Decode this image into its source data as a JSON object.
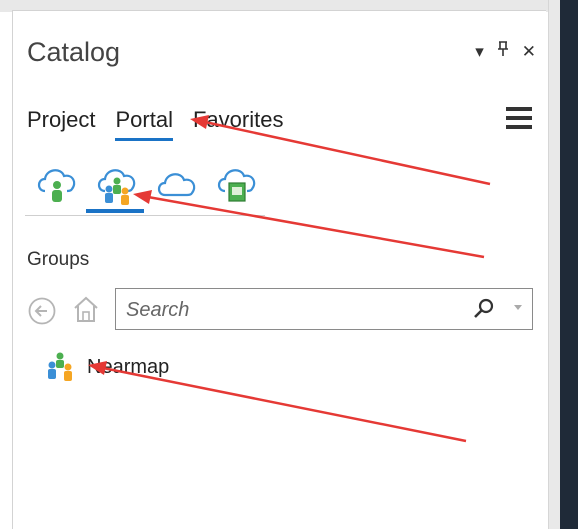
{
  "catalog": {
    "title": "Catalog",
    "controls": [
      "dropdown",
      "pin",
      "close"
    ]
  },
  "tabs": [
    {
      "label": "Project",
      "active": false
    },
    {
      "label": "Portal",
      "active": true
    },
    {
      "label": "Favorites",
      "active": false
    }
  ],
  "source_icons": [
    "my-content-cloud-icon",
    "groups-cloud-icon",
    "all-portal-cloud-icon",
    "living-atlas-cloud-icon"
  ],
  "section": {
    "label": "Groups"
  },
  "search": {
    "placeholder": "Search",
    "value": ""
  },
  "groups": [
    {
      "label": "Nearmap"
    }
  ],
  "colors": {
    "accent": "#1a73c6",
    "annotation": "#e53935"
  }
}
